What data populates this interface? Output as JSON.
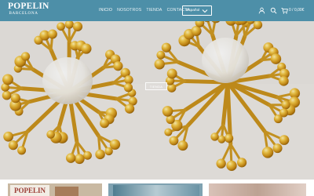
{
  "header": {
    "logo_main": "POPELIN",
    "logo_sub": "BARCELONA",
    "nav": [
      "INICIO",
      "NOSOTROS",
      "TIENDA",
      "CONTACTA"
    ],
    "language": "Español",
    "cart_text": "0 / 0,00€"
  },
  "hero": {
    "cta_label": "TIENDA"
  },
  "bottom": {
    "strip1_label": "POPELIN"
  },
  "colors": {
    "header_bg": "#4d8fa8",
    "gold": "#d6a12a"
  },
  "icons": [
    "user-icon",
    "search-icon",
    "cart-icon",
    "chevron-down-icon"
  ]
}
